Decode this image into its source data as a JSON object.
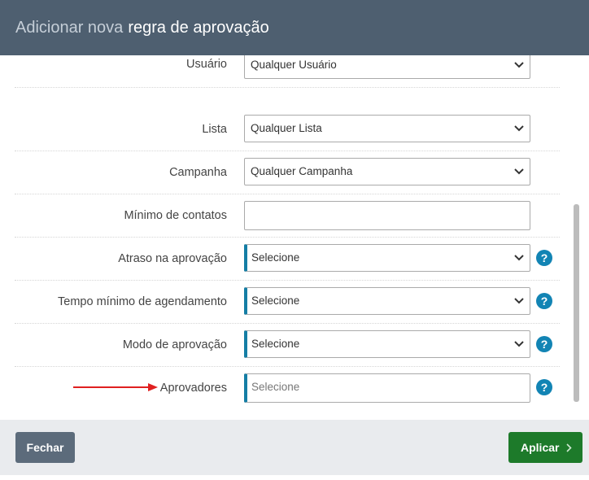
{
  "header": {
    "title_light": "Adicionar nova",
    "title_strong": "regra de aprovação"
  },
  "form": {
    "rows": [
      {
        "label": "Usuário",
        "value": "Qualquer Usuário"
      },
      {
        "label": "Lista",
        "value": "Qualquer Lista"
      },
      {
        "label": "Campanha",
        "value": "Qualquer Campanha"
      },
      {
        "label": "Mínimo de contatos",
        "value": ""
      },
      {
        "label": "Atraso na aprovação",
        "value": "Selecione"
      },
      {
        "label": "Tempo mínimo de agendamento",
        "value": "Selecione"
      },
      {
        "label": "Modo de aprovação",
        "value": "Selecione"
      },
      {
        "label": "Aprovadores",
        "placeholder": "Selecione"
      }
    ],
    "help_glyph": "?"
  },
  "footer": {
    "close_label": "Fechar",
    "apply_label": "Aplicar"
  },
  "colors": {
    "header_bg": "#4e5f70",
    "required_accent": "#157ea5",
    "help": "#1284b4",
    "apply": "#1d7a2a",
    "close": "#5c6b7b",
    "arrow": "#e02020"
  },
  "icons": {
    "select_chevron": "chevron-down-icon",
    "apply_chevron": "chevron-right-icon",
    "help": "help-icon",
    "annotation": "red-arrow-icon"
  }
}
